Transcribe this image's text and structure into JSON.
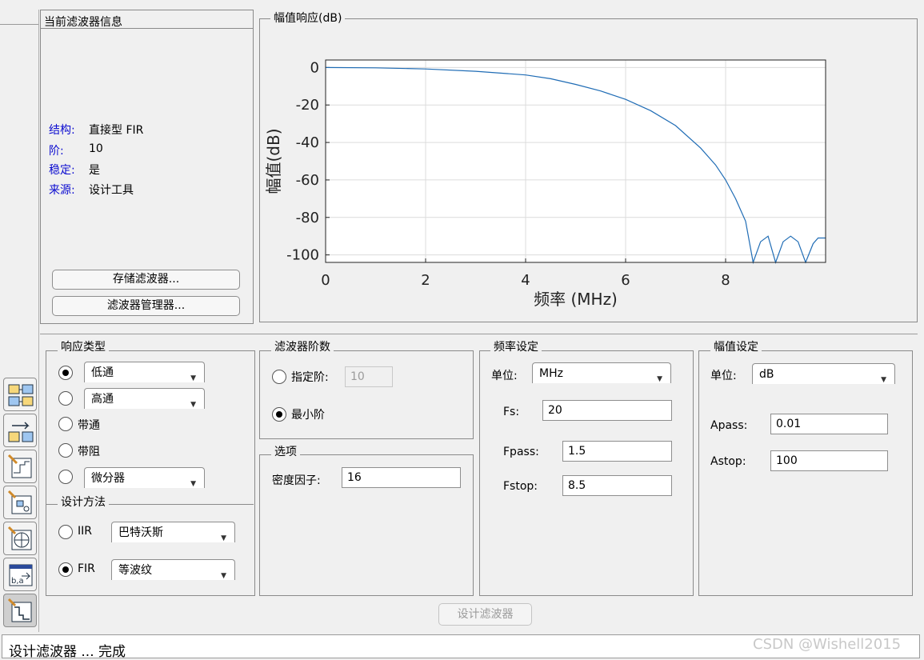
{
  "info": {
    "title": "当前滤波器信息",
    "rows": [
      {
        "key": "结构:",
        "value": "直接型 FIR"
      },
      {
        "key": "阶:",
        "value": "10"
      },
      {
        "key": "稳定:",
        "value": "是"
      },
      {
        "key": "来源:",
        "value": "设计工具"
      }
    ],
    "store_button": "存储滤波器...",
    "manager_button": "滤波器管理器..."
  },
  "plot": {
    "panel_title": "幅值响应(dB)"
  },
  "chart_data": {
    "type": "line",
    "title": "",
    "xlabel": "频率 (MHz)",
    "ylabel": "幅值(dB)",
    "xlim": [
      0,
      10
    ],
    "ylim": [
      -104,
      4
    ],
    "x_ticks": [
      "0",
      "2",
      "4",
      "6",
      "8"
    ],
    "y_ticks": [
      "0",
      "-20",
      "-40",
      "-60",
      "-80",
      "-100"
    ],
    "grid": true,
    "color": "#1f6cb5",
    "series": [
      {
        "x": [
          0,
          1,
          2,
          3,
          4,
          4.5,
          5,
          5.5,
          6,
          6.5,
          7,
          7.5,
          7.8,
          8.0,
          8.2,
          8.4,
          8.55,
          8.7,
          8.85,
          9.0,
          9.15,
          9.3,
          9.45,
          9.6,
          9.75,
          9.85,
          10.0
        ],
        "values": [
          0,
          -0.2,
          -0.8,
          -2,
          -4,
          -6,
          -9,
          -12.5,
          -17,
          -23,
          -31,
          -43,
          -52,
          -60,
          -70,
          -82,
          -104,
          -93,
          -90,
          -104,
          -93,
          -90,
          -93,
          -104,
          -94,
          -91,
          -91
        ]
      }
    ]
  },
  "response_type": {
    "title": "响应类型",
    "options": [
      {
        "label": "低通",
        "selected": true
      },
      {
        "label": "高通",
        "selected": false
      },
      {
        "label": "带通",
        "selected": false
      },
      {
        "label": "带阻",
        "selected": false
      },
      {
        "label": "微分器",
        "selected": false
      }
    ]
  },
  "design_method": {
    "title": "设计方法",
    "iir_label": "IIR",
    "iir_value": "巴特沃斯",
    "fir_label": "FIR",
    "fir_value": "等波纹",
    "fir_selected": true
  },
  "order": {
    "title": "滤波器阶数",
    "specify_label": "指定阶:",
    "specify_value": "10",
    "minimum_label": "最小阶",
    "minimum_selected": true
  },
  "options": {
    "title": "选项",
    "density_label": "密度因子:",
    "density_value": "16"
  },
  "freq": {
    "title": "频率设定",
    "unit_label": "单位:",
    "unit_value": "MHz",
    "fs_label": "Fs:",
    "fs_value": "20",
    "fpass_label": "Fpass:",
    "fpass_value": "1.5",
    "fstop_label": "Fstop:",
    "fstop_value": "8.5"
  },
  "mag": {
    "title": "幅值设定",
    "unit_label": "单位:",
    "unit_value": "dB",
    "apass_label": "Apass:",
    "apass_value": "0.01",
    "astop_label": "Astop:",
    "astop_value": "100"
  },
  "design_button": "设计滤波器",
  "status": "设计滤波器 ... 完成",
  "watermark": "CSDN @Wishell2015"
}
